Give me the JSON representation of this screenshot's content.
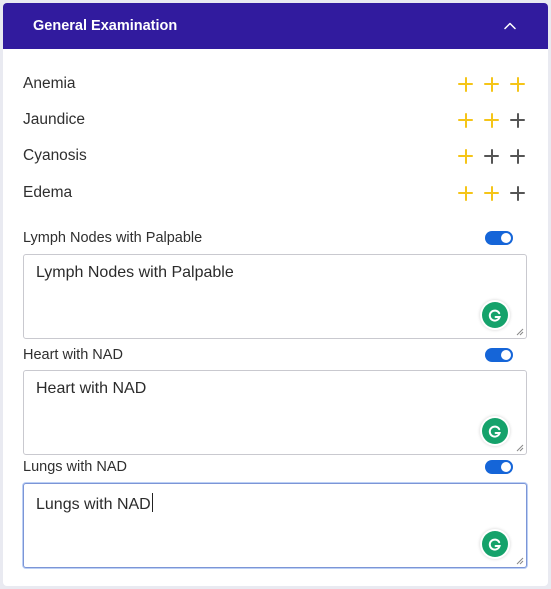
{
  "header": {
    "title": "General Examination",
    "collapse_icon": "chevron-up-icon"
  },
  "colors": {
    "header_bg": "#311b9e",
    "plus_active": "#f5c518",
    "plus_inactive": "#555555",
    "toggle_on": "#1565d8",
    "grammarly": "#15a26b"
  },
  "scores": [
    {
      "id": "anemia",
      "label": "Anemia",
      "level": 3,
      "max": 3
    },
    {
      "id": "jaundice",
      "label": "Jaundice",
      "level": 2,
      "max": 3
    },
    {
      "id": "cyanosis",
      "label": "Cyanosis",
      "level": 1,
      "max": 3
    },
    {
      "id": "edema",
      "label": "Edema",
      "level": 2,
      "max": 3
    }
  ],
  "sections": [
    {
      "id": "lymph",
      "label": "Lymph Nodes with Palpable",
      "toggle_on": true,
      "text": "Lymph Nodes with Palpable"
    },
    {
      "id": "heart",
      "label": "Heart with NAD",
      "toggle_on": true,
      "text": "Heart with NAD"
    },
    {
      "id": "lungs",
      "label": "Lungs with NAD",
      "toggle_on": true,
      "text": "Lungs with NAD"
    }
  ]
}
